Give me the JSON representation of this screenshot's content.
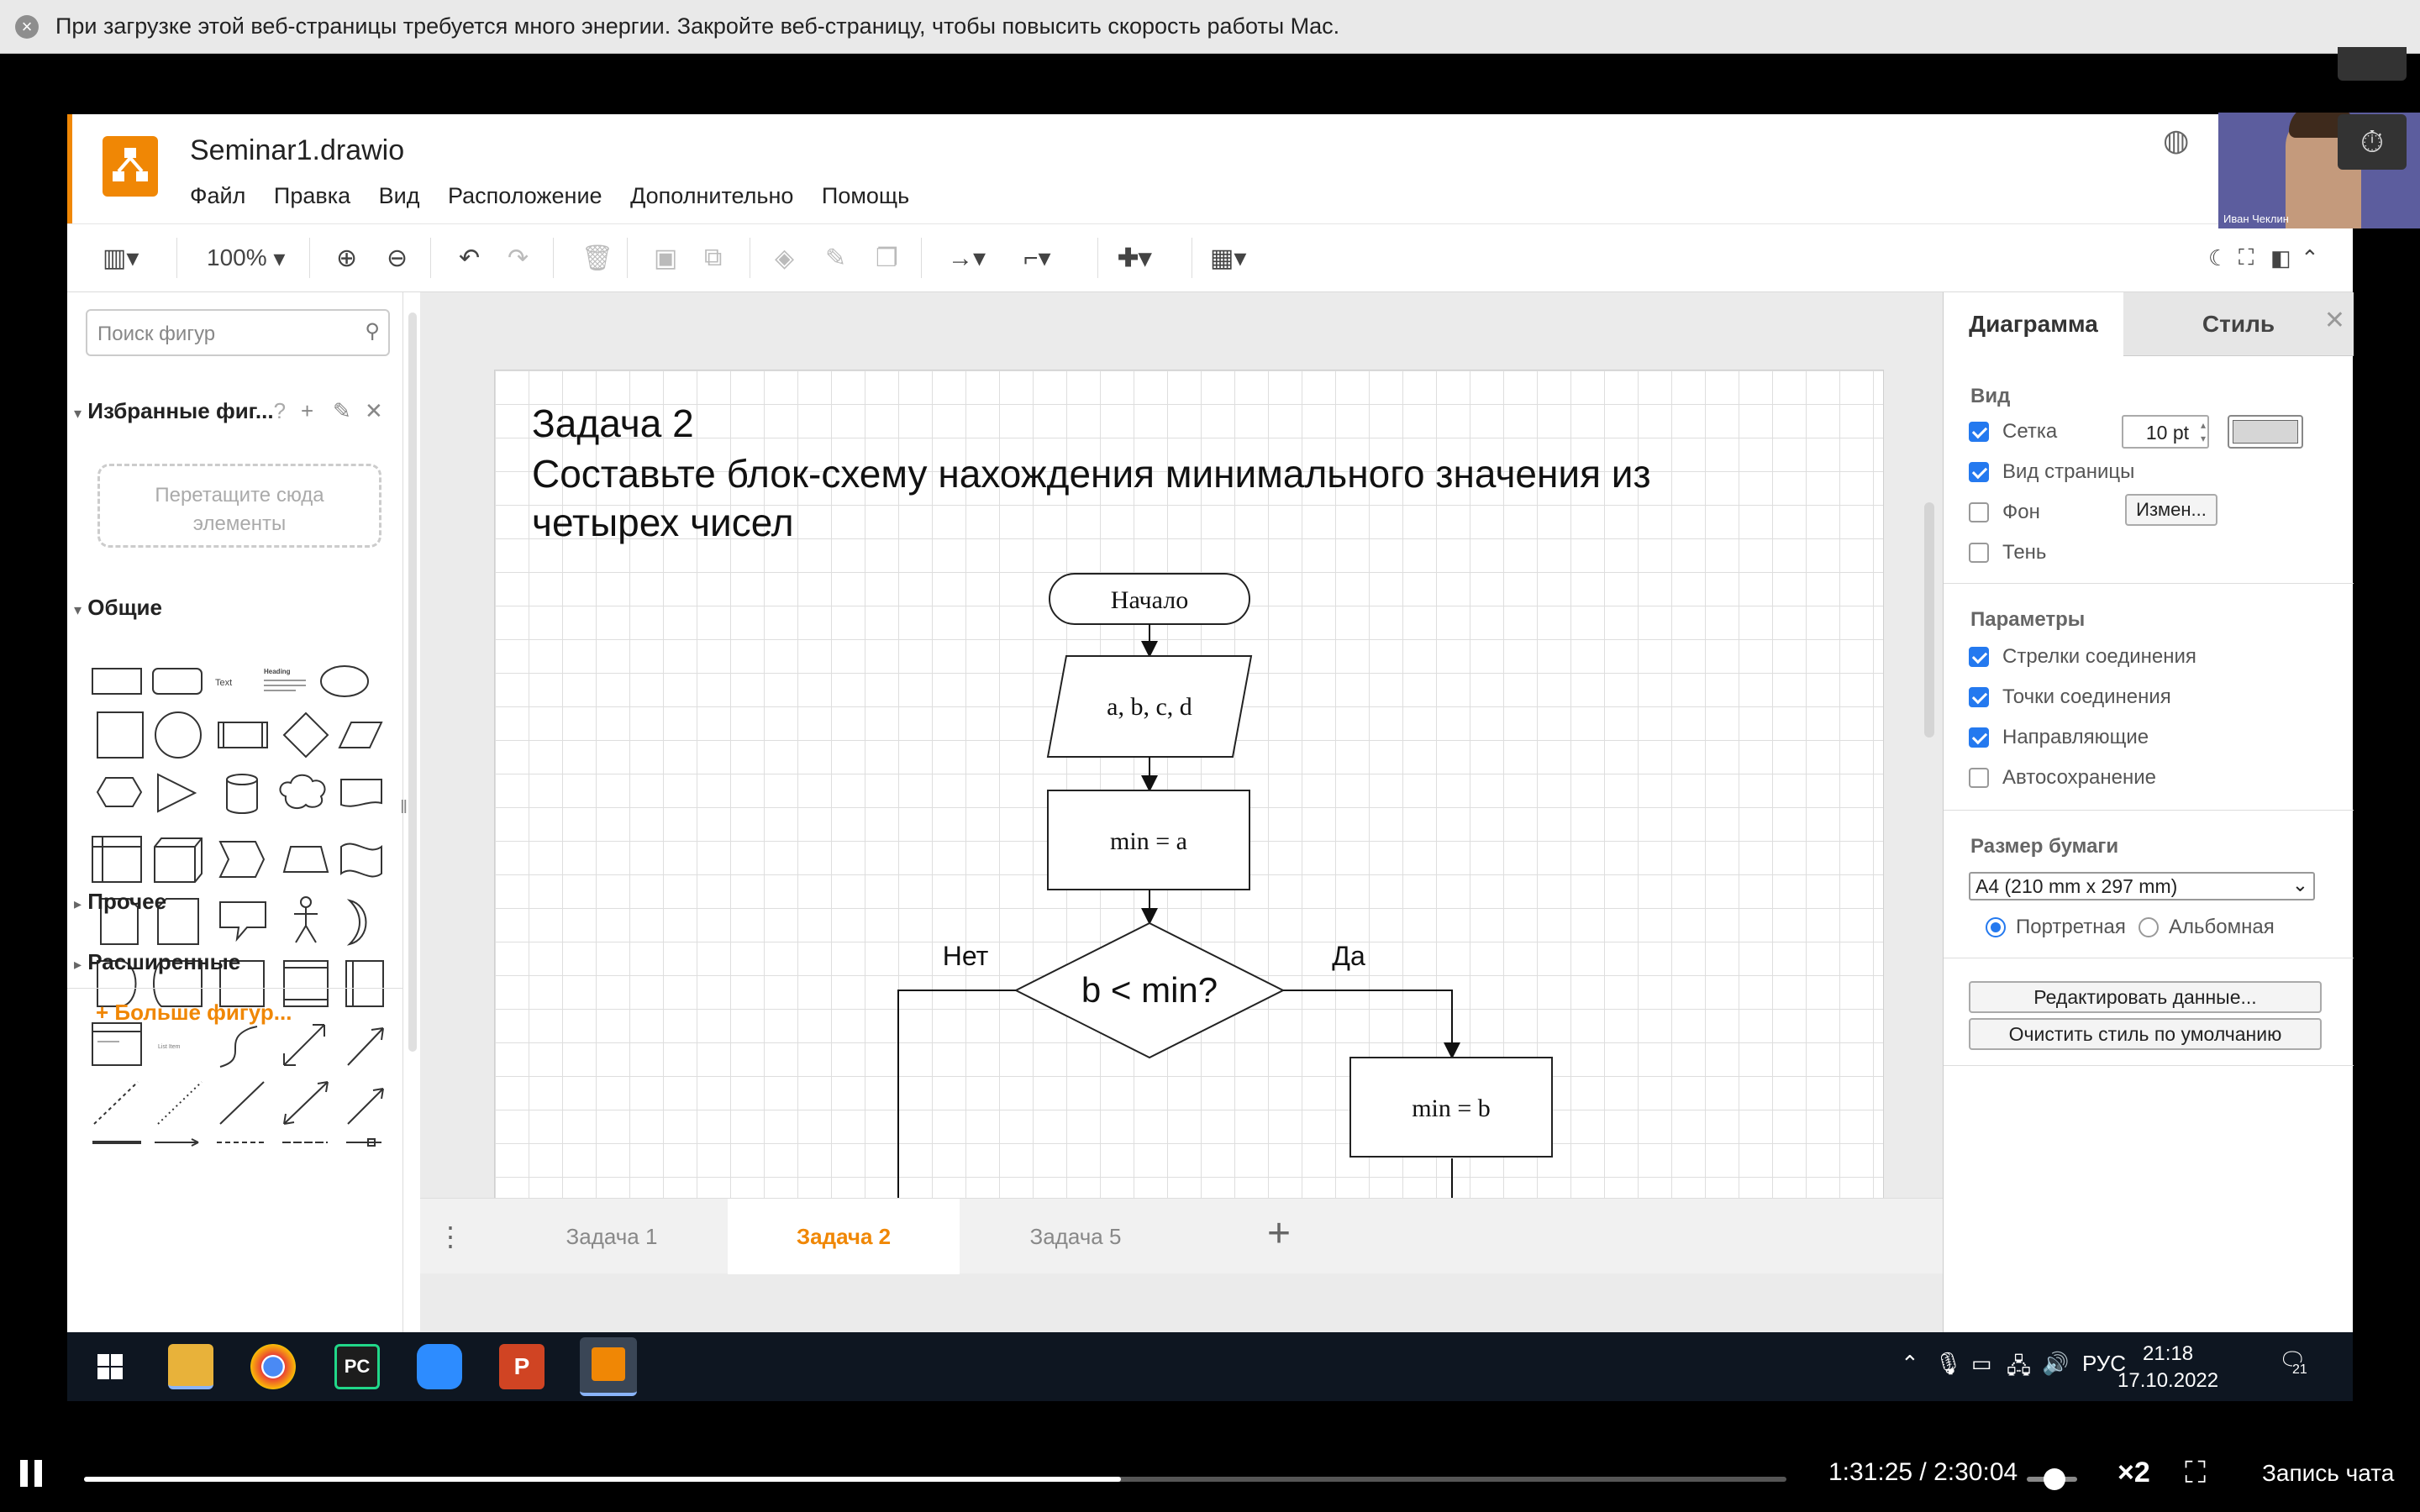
{
  "notification": {
    "text": "При загрузке этой веб-страницы требуется много энергии. Закройте веб-страницу, чтобы повысить скорость работы Mac."
  },
  "app": {
    "title": "Seminar1.drawio",
    "menu": [
      "Файл",
      "Правка",
      "Вид",
      "Расположение",
      "Дополнительно",
      "Помощь"
    ]
  },
  "toolbar": {
    "zoom": "100%"
  },
  "sidebar": {
    "search_placeholder": "Поиск фигур",
    "favorites_title": "Избранные фиг...",
    "favorites_help": "?",
    "drop_hint": "Перетащите сюда элементы",
    "general_title": "Общие",
    "shape_text_label": "Text",
    "shape_heading_label": "Heading",
    "shape_list_label": "List Item",
    "other_title": "Прочее",
    "advanced_title": "Расширенные",
    "more_shapes": "+ Больше фигур..."
  },
  "diagram": {
    "heading_line1": "Задача 2",
    "heading_line2": "Составьте блок-схему нахождения минимального значения из четырех чисел",
    "start": "Начало",
    "input": "a, b, c, d",
    "assign1": "min = a",
    "decision": "b < min?",
    "no_label": "Нет",
    "yes_label": "Да",
    "assign2": "min = b"
  },
  "pages": {
    "tabs": [
      "Задача 1",
      "Задача 2",
      "Задача 5"
    ],
    "active_index": 1
  },
  "format_panel": {
    "tab_diagram": "Диаграмма",
    "tab_style": "Стиль",
    "view_title": "Вид",
    "grid_label": "Сетка",
    "grid_size": "10 pt",
    "page_view_label": "Вид страницы",
    "background_label": "Фон",
    "change_button": "Измен...",
    "shadow_label": "Тень",
    "options_title": "Параметры",
    "connection_arrows": "Стрелки соединения",
    "connection_points": "Точки соединения",
    "guides": "Направляющие",
    "autosave": "Автосохранение",
    "paper_size_title": "Размер бумаги",
    "paper_size_value": "A4 (210 mm x 297 mm)",
    "portrait": "Портретная",
    "landscape": "Альбомная",
    "edit_data_button": "Редактировать данные...",
    "clear_style_button": "Очистить стиль по умолчанию"
  },
  "webcam": {
    "name": "Иван Чеклин"
  },
  "taskbar": {
    "lang": "РУС",
    "time": "21:18",
    "date": "17.10.2022",
    "notif_count": "21"
  },
  "player": {
    "time": "1:31:25  /  2:30:04",
    "progress": 0.609,
    "speed": "×2",
    "chat": "Запись чата"
  }
}
